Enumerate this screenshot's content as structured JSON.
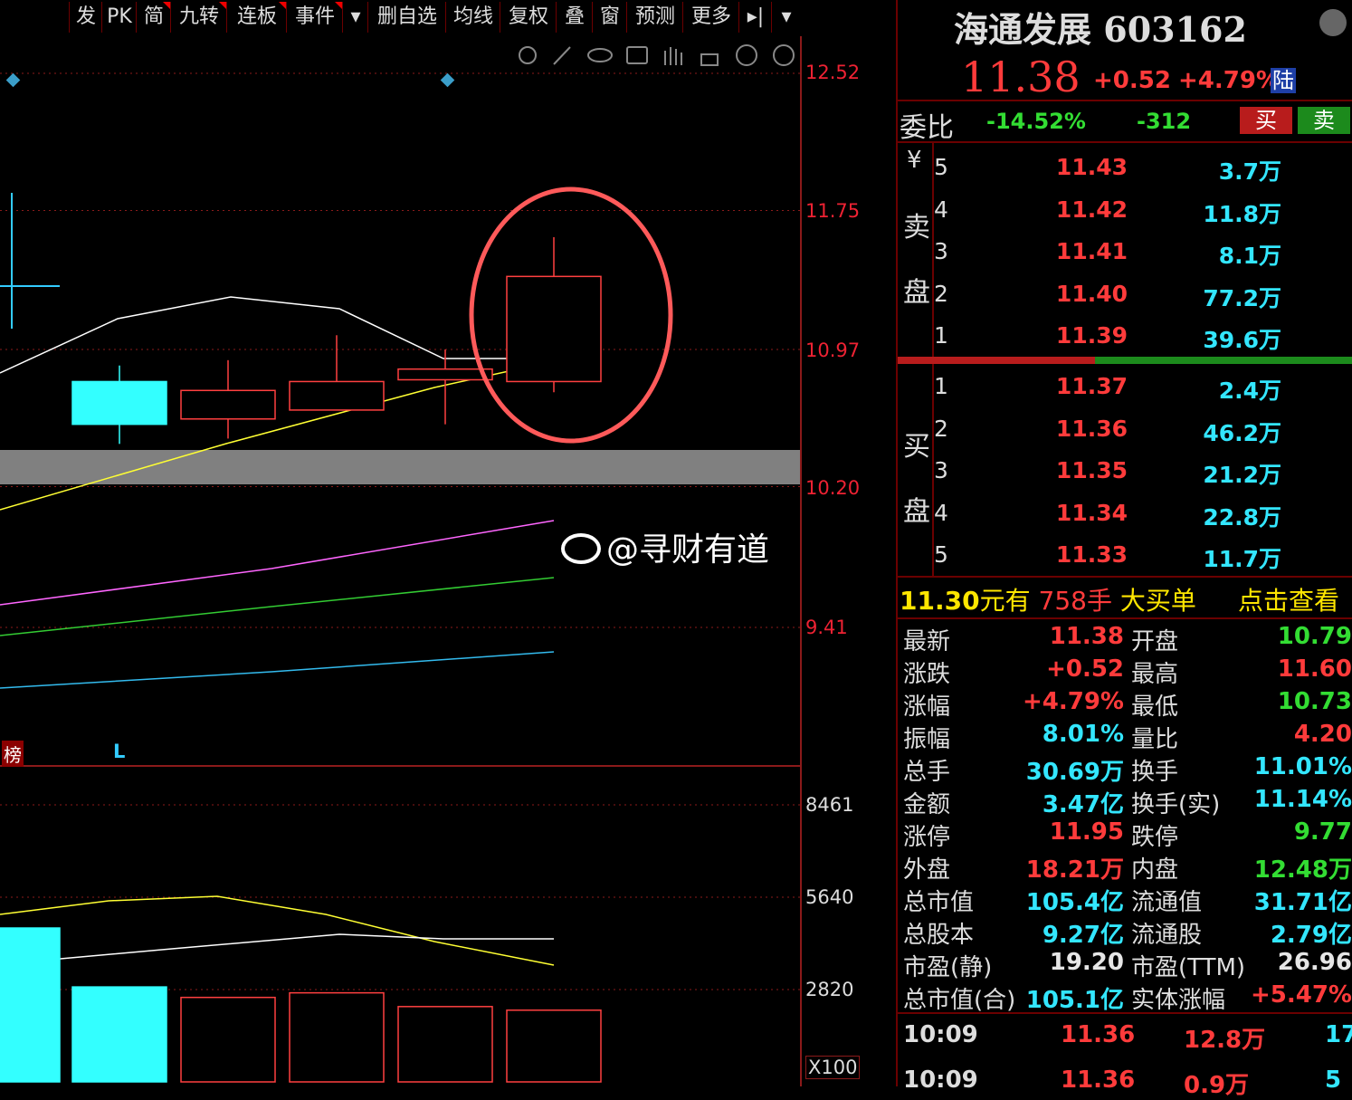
{
  "toolbar": {
    "items": [
      "发",
      "PK",
      "简",
      "九转",
      "连板",
      "事件",
      "▾",
      "删自选",
      "均线",
      "复权",
      "叠",
      "窗",
      "预测",
      "更多",
      "▸|",
      "▾"
    ]
  },
  "chart": {
    "price_axis": [
      "12.52",
      "11.75",
      "10.97",
      "10.20",
      "9.41"
    ],
    "volume_axis": [
      "8461",
      "5640",
      "2820",
      "X100"
    ],
    "markers": {
      "bang": "榜",
      "l": "L"
    },
    "watermark": "@寻财有道",
    "colors": {
      "up": "#ff4040",
      "down": "#33ffff",
      "ma5": "#ffffff",
      "ma10": "#ffff33",
      "ma20": "#ff66ff",
      "ma30": "#33cc33",
      "ma60": "#33bbee",
      "highlight": "#ff5a5a"
    }
  },
  "chart_data": {
    "type": "candlestick",
    "candles": [
      {
        "open": 10.79,
        "close": 10.55,
        "high": 10.88,
        "low": 10.44,
        "direction": "down"
      },
      {
        "open": 10.58,
        "close": 10.74,
        "high": 10.91,
        "low": 10.47,
        "direction": "up"
      },
      {
        "open": 10.63,
        "close": 10.79,
        "high": 11.05,
        "low": 10.63,
        "direction": "up"
      },
      {
        "open": 10.8,
        "close": 10.86,
        "high": 10.97,
        "low": 10.55,
        "direction": "up"
      },
      {
        "open": 10.79,
        "close": 11.38,
        "high": 11.6,
        "low": 10.73,
        "direction": "up"
      }
    ],
    "volumes": [
      {
        "value": 4700,
        "direction": "down"
      },
      {
        "value": 2900,
        "direction": "down"
      },
      {
        "value": 2580,
        "direction": "up"
      },
      {
        "value": 2720,
        "direction": "up"
      },
      {
        "value": 2300,
        "direction": "up"
      },
      {
        "value": 2190,
        "direction": "up"
      }
    ],
    "price_ylim": [
      9.41,
      12.52
    ],
    "volume_ylim": [
      0,
      8461
    ]
  },
  "quote": {
    "name": "海通发展",
    "code": "603162",
    "price": "11.38",
    "change": "+0.52",
    "change_pct": "+4.79%",
    "market_tag": "陆",
    "weibi_label": "委比",
    "weibi_pct": "-14.52%",
    "weicha": "-312",
    "buy_button": "买",
    "sell_button": "卖",
    "yen": "¥",
    "sell_chars": [
      "卖",
      "盘"
    ],
    "buy_chars": [
      "买",
      "盘"
    ],
    "asks": [
      {
        "level": "5",
        "price": "11.43",
        "vol": "3.7万"
      },
      {
        "level": "4",
        "price": "11.42",
        "vol": "11.8万"
      },
      {
        "level": "3",
        "price": "11.41",
        "vol": "8.1万"
      },
      {
        "level": "2",
        "price": "11.40",
        "vol": "77.2万"
      },
      {
        "level": "1",
        "price": "11.39",
        "vol": "39.6万"
      }
    ],
    "bids": [
      {
        "level": "1",
        "price": "11.37",
        "vol": "2.4万"
      },
      {
        "level": "2",
        "price": "11.36",
        "vol": "46.2万"
      },
      {
        "level": "3",
        "price": "11.35",
        "vol": "21.2万"
      },
      {
        "level": "4",
        "price": "11.34",
        "vol": "22.8万"
      },
      {
        "level": "5",
        "price": "11.33",
        "vol": "11.7万"
      }
    ],
    "big_order": {
      "price": "11.30",
      "yuan": "元有",
      "qty": "758手",
      "label": "大买单",
      "link": "点击查看"
    },
    "stats": [
      {
        "k1": "最新",
        "v1": "11.38",
        "c1": "red",
        "k2": "开盘",
        "v2": "10.79",
        "c2": "green"
      },
      {
        "k1": "涨跌",
        "v1": "+0.52",
        "c1": "red",
        "k2": "最高",
        "v2": "11.60",
        "c2": "red"
      },
      {
        "k1": "涨幅",
        "v1": "+4.79%",
        "c1": "red",
        "k2": "最低",
        "v2": "10.73",
        "c2": "green"
      },
      {
        "k1": "振幅",
        "v1": "8.01%",
        "c1": "cyan",
        "k2": "量比",
        "v2": "4.20",
        "c2": "red"
      },
      {
        "k1": "总手",
        "v1": "30.69万",
        "c1": "cyan",
        "k2": "换手",
        "v2": "11.01%",
        "c2": "cyan"
      },
      {
        "k1": "金额",
        "v1": "3.47亿",
        "c1": "cyan",
        "k2": "换手(实)",
        "v2": "11.14%",
        "c2": "cyan"
      },
      {
        "k1": "涨停",
        "v1": "11.95",
        "c1": "red",
        "k2": "跌停",
        "v2": "9.77",
        "c2": "green"
      },
      {
        "k1": "外盘",
        "v1": "18.21万",
        "c1": "red",
        "k2": "内盘",
        "v2": "12.48万",
        "c2": "green"
      },
      {
        "k1": "总市值",
        "v1": "105.4亿",
        "c1": "cyan",
        "k2": "流通值",
        "v2": "31.71亿",
        "c2": "cyan"
      },
      {
        "k1": "总股本",
        "v1": "9.27亿",
        "c1": "cyan",
        "k2": "流通股",
        "v2": "2.79亿",
        "c2": "cyan"
      },
      {
        "k1": "市盈(静)",
        "v1": "19.20",
        "c1": "white",
        "k2": "市盈(TTM)",
        "v2": "26.96",
        "c2": "white"
      },
      {
        "k1": "总市值(合)",
        "v1": "105.1亿",
        "c1": "cyan",
        "k2": "实体涨幅",
        "v2": "+5.47%",
        "c2": "red"
      }
    ],
    "ticks": [
      {
        "time": "10:09",
        "price": "11.36",
        "vol": "12.8万",
        "count": "17"
      },
      {
        "time": "10:09",
        "price": "11.36",
        "vol": "0.9万",
        "count": "5"
      }
    ]
  }
}
